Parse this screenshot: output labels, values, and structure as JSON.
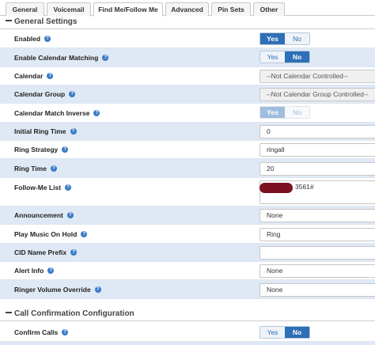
{
  "tabs": [
    "General",
    "Voicemail",
    "Find Me/Follow Me",
    "Advanced",
    "Pin Sets",
    "Other"
  ],
  "active_tab": "Find Me/Follow Me",
  "sections": {
    "general": "General Settings",
    "confirm": "Call Confirmation Configuration"
  },
  "rows": {
    "enabled": {
      "label": "Enabled",
      "yes": "Yes",
      "no": "No",
      "selected": "Yes"
    },
    "calendar_matching": {
      "label": "Enable Calendar Matching",
      "yes": "Yes",
      "no": "No",
      "selected": "No"
    },
    "calendar": {
      "label": "Calendar",
      "value": "--Not Calendar Controlled--"
    },
    "calendar_group": {
      "label": "Calendar Group",
      "value": "--Not Calendar Group Controlled--"
    },
    "calendar_inverse": {
      "label": "Calendar Match Inverse",
      "yes": "Yes",
      "no": "No",
      "selected": "Yes",
      "disabled": true
    },
    "initial_ring_time": {
      "label": "Initial Ring Time",
      "value": "0"
    },
    "ring_strategy": {
      "label": "Ring Strategy",
      "value": "ringall"
    },
    "ring_time": {
      "label": "Ring Time",
      "value": "20"
    },
    "followme_list": {
      "label": "Follow-Me List",
      "value": "3561#"
    },
    "announcement": {
      "label": "Announcement",
      "value": "None"
    },
    "moh": {
      "label": "Play Music On Hold",
      "value": "Ring"
    },
    "cid_prefix": {
      "label": "CID Name Prefix",
      "value": ""
    },
    "alert_info": {
      "label": "Alert Info",
      "value": "None"
    },
    "ringer_volume": {
      "label": "Ringer Volume Override",
      "value": "None"
    },
    "confirm_calls": {
      "label": "Confirm Calls",
      "yes": "Yes",
      "no": "No",
      "selected": "No"
    }
  },
  "colors": {
    "accent": "#2e6fb7",
    "row_alt": "#dfe9f5",
    "redaction": "#7a1020"
  }
}
